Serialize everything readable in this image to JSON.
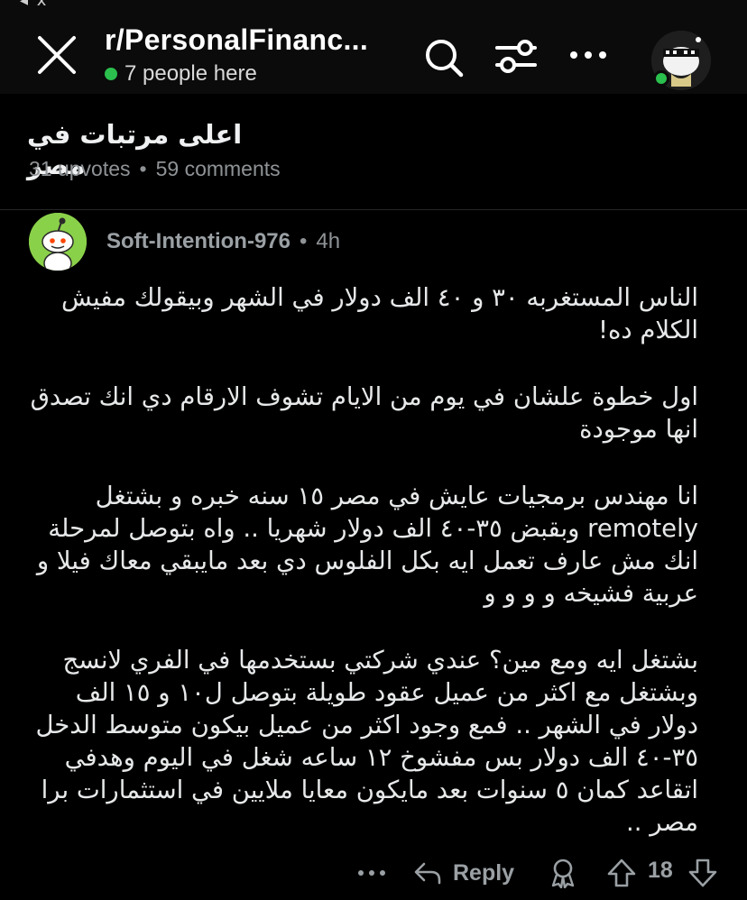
{
  "status_bar": {
    "fragment": "◂ x"
  },
  "header": {
    "subreddit": "r/PersonalFinanc...",
    "online_text": "7 people here",
    "icons": [
      "close-icon",
      "search-icon",
      "filter-icon",
      "more-icon",
      "user-avatar"
    ],
    "accent_online": "#2bbf4d"
  },
  "post": {
    "title": "اعلى مرتبات في مصر",
    "upvotes": "31 upvotes",
    "separator": "•",
    "comments": "59 comments"
  },
  "comment": {
    "author": "Soft-Intention-976",
    "separator": "•",
    "time": "4h",
    "avatar_color": "#8ad14a",
    "paragraphs": [
      "الناس المستغربه ٣٠ و ٤٠ الف دولار في الشهر وبيقولك مفيش الكلام ده!",
      "اول خطوة علشان في يوم من الايام تشوف الارقام دي انك تصدق انها موجودة",
      "انا مهندس برمجيات عايش في مصر ١٥ سنه خبره و بشتغل remotely وبقبض ٣٥-٤٠ الف دولار شهريا .. واه بتوصل لمرحلة انك مش عارف تعمل ايه بكل الفلوس دي بعد مايبقي معاك فيلا و عربية فشيخه و و و و",
      "بشتغل ايه ومع مين؟ عندي شركتي بستخدمها في الفري لانسج وبشتغل مع اكثر من عميل عقود طويلة بتوصل ل١٠ و ١٥ الف دولار في الشهر .. فمع وجود اكثر من عميل بيكون متوسط الدخل ٣٥-٤٠ الف دولار بس مفشوخ ١٢ ساعه شغل في اليوم وهدفي اتقاعد كمان ٥ سنوات بعد مايكون معايا ملايين في استثمارات برا مصر .."
    ],
    "actions": {
      "reply_label": "Reply",
      "vote_count": "18"
    }
  }
}
